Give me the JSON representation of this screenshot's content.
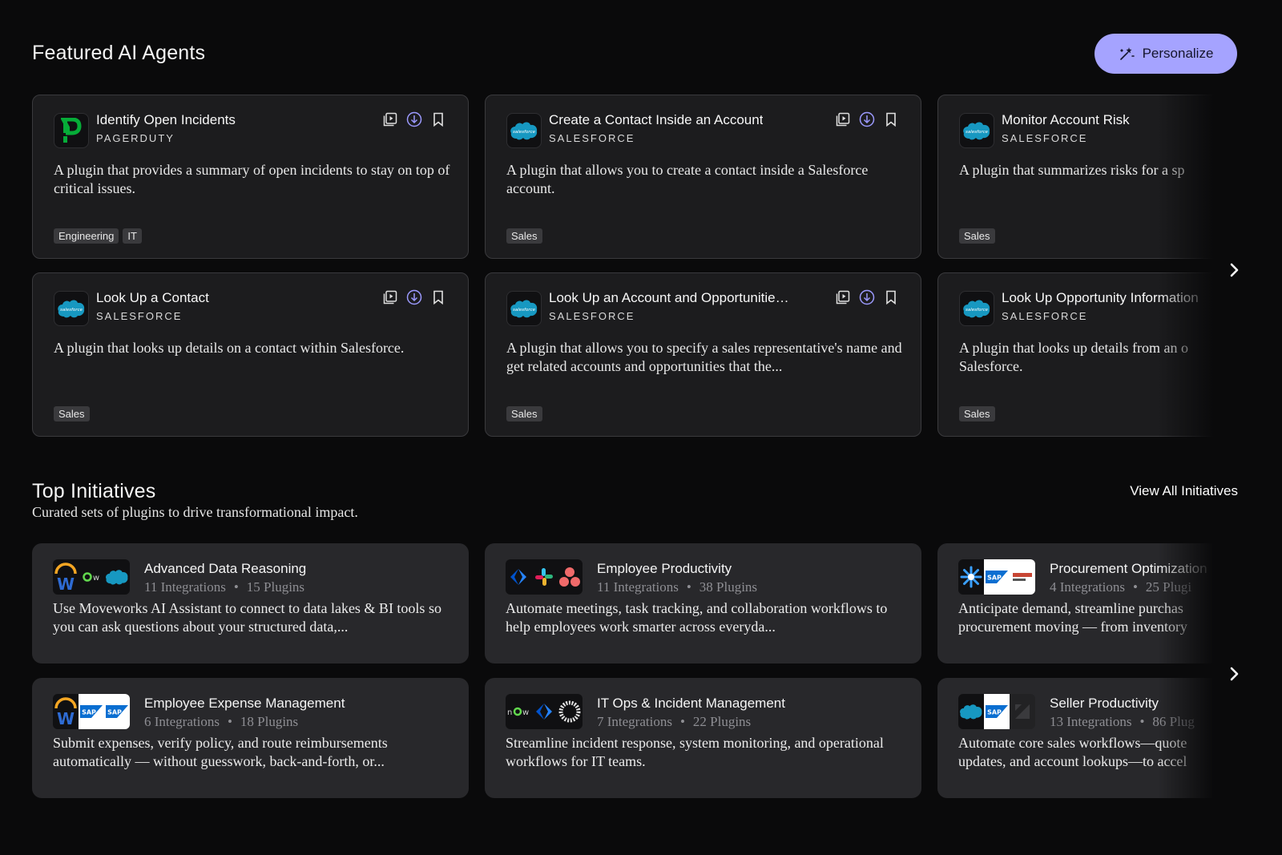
{
  "featured": {
    "title": "Featured AI Agents",
    "personalize_label": "Personalize",
    "agents": [
      {
        "name": "Identify Open Incidents",
        "vendor": "PAGERDUTY",
        "logo": "pagerduty-logo",
        "description": "A plugin that provides a summary of open incidents to stay on top of critical issues.",
        "tags": [
          "Engineering",
          "IT"
        ]
      },
      {
        "name": "Create a Contact Inside an Account",
        "vendor": "SALESFORCE",
        "logo": "salesforce-logo",
        "description": "A plugin that allows you to create a contact inside a Salesforce account.",
        "tags": [
          "Sales"
        ]
      },
      {
        "name": "Monitor Account Risk",
        "vendor": "SALESFORCE",
        "logo": "salesforce-logo",
        "description": "A plugin that summarizes risks for a sp",
        "tags": [
          "Sales"
        ]
      },
      {
        "name": "Look Up a Contact",
        "vendor": "SALESFORCE",
        "logo": "salesforce-logo",
        "description": "A plugin that looks up details on a contact within Salesforce.",
        "tags": [
          "Sales"
        ]
      },
      {
        "name": "Look Up an Account and Opportunities by...",
        "vendor": "SALESFORCE",
        "logo": "salesforce-logo",
        "description": "A plugin that allows you to specify a sales representative's name and get related accounts and opportunities that the...",
        "tags": [
          "Sales"
        ]
      },
      {
        "name": "Look Up Opportunity Information",
        "vendor": "SALESFORCE",
        "logo": "salesforce-logo",
        "description": "A plugin that looks up details from an o Salesforce.",
        "tags": [
          "Sales"
        ]
      }
    ]
  },
  "initiatives": {
    "title": "Top Initiatives",
    "subtitle": "Curated sets of plugins to drive transformational impact.",
    "view_all_label": "View All Initiatives",
    "items": [
      {
        "name": "Advanced Data Reasoning",
        "integrations": "11 Integrations",
        "plugins": "15 Plugins",
        "logos": [
          "workday-logo",
          "servicenow-logo",
          "salesforce-logo"
        ],
        "description": "Use Moveworks AI Assistant to connect to data lakes & BI tools so you can ask questions about your structured data,..."
      },
      {
        "name": "Employee Productivity",
        "integrations": "11 Integrations",
        "plugins": "38 Plugins",
        "logos": [
          "jira-logo",
          "slack-logo",
          "asana-logo"
        ],
        "description": "Automate meetings, task tracking, and collaboration workflows to help employees work smarter across everyda..."
      },
      {
        "name": "Procurement Optimization",
        "integrations": "4 Integrations",
        "plugins": "25 Plugi",
        "logos": [
          "coupa-logo",
          "sap-logo",
          "oracle-erp-logo"
        ],
        "description": "Anticipate demand, streamline purchas procurement moving — from inventory"
      },
      {
        "name": "Employee Expense Management",
        "integrations": "6 Integrations",
        "plugins": "18 Plugins",
        "logos": [
          "workday-logo",
          "sap-logo",
          "sap-logo"
        ],
        "description": "Submit expenses, verify policy, and route reimbursements automatically — without guesswork, back-and-forth, or..."
      },
      {
        "name": "IT Ops & Incident Management",
        "integrations": "7 Integrations",
        "plugins": "22 Plugins",
        "logos": [
          "servicenow-logo",
          "jira-logo",
          "opsgenie-logo"
        ],
        "description": "Streamline incident response, system monitoring, and operational workflows for IT teams."
      },
      {
        "name": "Seller Productivity",
        "integrations": "13 Integrations",
        "plugins": "86 Plug",
        "logos": [
          "salesforce-logo",
          "sap-logo",
          "zendesk-logo"
        ],
        "description": "Automate core sales workflows—quote updates, and account lookups—to accel"
      }
    ]
  },
  "colors": {
    "accent": "#a5a3ff",
    "salesforce": "#1798c1",
    "pagerduty": "#06ac38",
    "jira": "#2684ff"
  },
  "icons": {
    "personalize": "magic-wand-icon",
    "preview": "preview-icon",
    "install": "download-icon",
    "bookmark": "bookmark-icon",
    "next": "chevron-right-icon"
  }
}
